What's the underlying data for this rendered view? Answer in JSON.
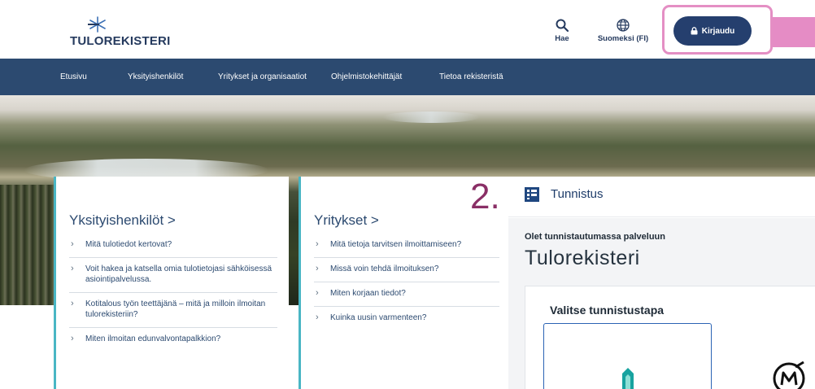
{
  "header": {
    "logo_text": "TULOREKISTERI",
    "search_label": "Hae",
    "language_label": "Suomeksi (FI)",
    "login_label": "Kirjaudu"
  },
  "nav": {
    "items": [
      {
        "label": "Etusivu"
      },
      {
        "label": "Yksityishenkilöt"
      },
      {
        "label": "Yritykset ja organisaatiot"
      },
      {
        "label": "Ohjelmistokehittäjät"
      },
      {
        "label": "Tietoa rekisteristä"
      }
    ]
  },
  "cards": [
    {
      "title": "Yksityishenkilöt >",
      "items": [
        {
          "text": "Mitä tulotiedot kertovat?"
        },
        {
          "text": "Voit hakea ja katsella omia tulotietojasi sähköisessä asiointipalvelussa."
        },
        {
          "text": "Kotitalous työn teettäjänä – mitä ja milloin ilmoitan tulorekisteriin?"
        },
        {
          "text": "Miten ilmoitan edunvalvontapalkkion?"
        }
      ]
    },
    {
      "title": "Yritykset >",
      "items": [
        {
          "text": "Mitä tietoja tarvitsen ilmoittamiseen?"
        },
        {
          "text": "Missä voin tehdä ilmoituksen?"
        },
        {
          "text": "Miten korjaan tiedot?"
        },
        {
          "text": "Kuinka uusin varmenteen?"
        }
      ]
    }
  ],
  "step_number": "2.",
  "tunnistus": {
    "title": "Tunnistus",
    "subtitle": "Olet tunnistautumassa palveluun",
    "service_name": "Tulorekisteri",
    "choose_label": "Valitse tunnistustapa"
  },
  "colors": {
    "nav_bg": "#2c4a70",
    "login_bg": "#253f6e",
    "highlight_pink": "#e48fc4",
    "card_accent": "#49b6c4",
    "step_color": "#8a2f66"
  },
  "icons": {
    "search": "search-icon",
    "language": "globe-icon",
    "login": "lock-icon",
    "chevron": "chevron-right-icon",
    "tunnistus": "identification-icon",
    "method_bank": "bank-logo-icon",
    "method_mobile": "mobile-certificate-icon"
  }
}
